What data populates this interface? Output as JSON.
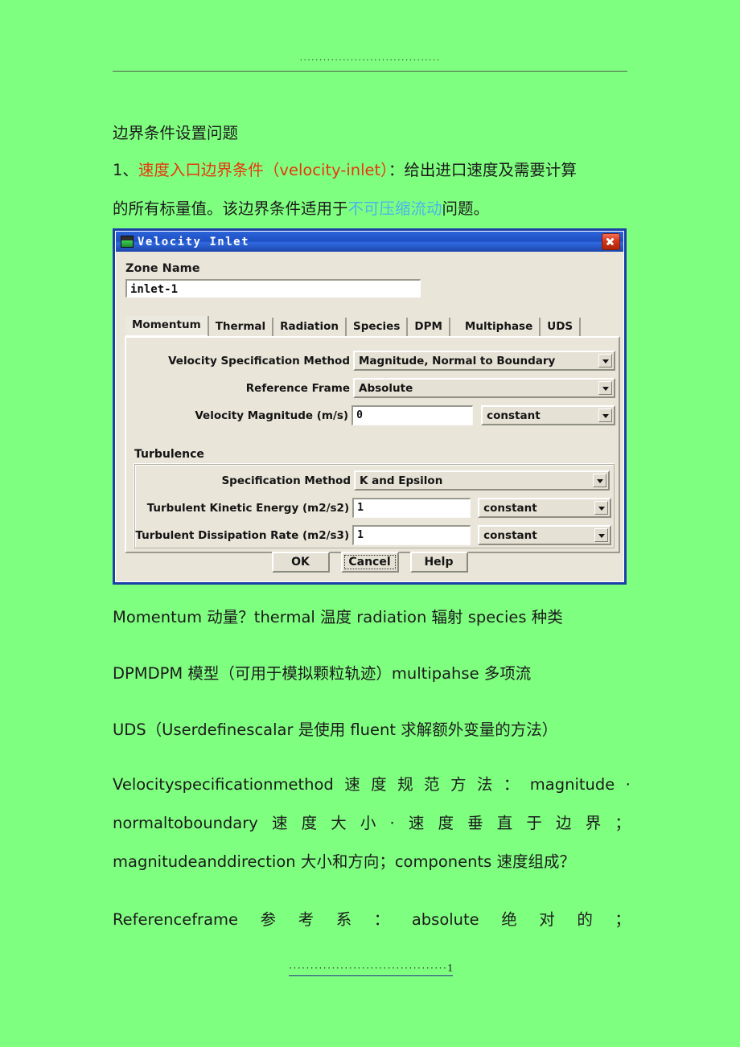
{
  "header": {
    "leader_dots": "····································",
    "rule": true
  },
  "document": {
    "title_line": "边界条件设置问题",
    "item1": {
      "number": "1、",
      "highlight": "速度入口边界条件（velocity-inlet）",
      "rest": "：给出进口速度及需要计算"
    },
    "item1_cont": {
      "pre": "的所有标量值。该边界条件适用于",
      "link": "不可压缩流动",
      "post": "问题。"
    },
    "note1": "Momentum 动量？thermal 温度 radiation 辐射 species 种类",
    "note2": "DPMDPM 模型（可用于模拟颗粒轨迹）multipahse 多项流",
    "note3": "UDS（Userdefinescalar 是使用 fluent 求解额外变量的方法）",
    "velocity_spec_line1": [
      "Velocityspecificationmethod",
      "速",
      "度",
      "规",
      "范",
      "方",
      "法",
      "：",
      "magnitude",
      "·"
    ],
    "velocity_spec_line2": [
      "normaltoboundary",
      "速",
      "度",
      "大",
      "小",
      "·",
      "速",
      "度",
      "垂",
      "直",
      "于",
      "边",
      "界",
      "；"
    ],
    "velocity_spec_line3": "magnitudeanddirection 大小和方向；components 速度组成？",
    "reference_frame_line": [
      "Referenceframe",
      "参",
      "考",
      "系",
      "：",
      "absolute",
      "绝",
      "对",
      "的",
      "；"
    ]
  },
  "footer": {
    "leader_dots": "·····································",
    "page_number": "1"
  },
  "dialog": {
    "title": "Velocity Inlet",
    "close_label": "×",
    "zone_name_label": "Zone Name",
    "zone_name_value": "inlet-1",
    "tabs": [
      {
        "label": "Momentum",
        "active": true
      },
      {
        "label": "Thermal",
        "active": false
      },
      {
        "label": "Radiation",
        "active": false
      },
      {
        "label": "Species",
        "active": false
      },
      {
        "label": "DPM",
        "active": false
      },
      {
        "label": "Multiphase",
        "active": false
      },
      {
        "label": "UDS",
        "active": false
      }
    ],
    "fields": {
      "velocity_spec_method": {
        "label": "Velocity Specification Method",
        "value": "Magnitude, Normal to Boundary"
      },
      "reference_frame": {
        "label": "Reference Frame",
        "value": "Absolute"
      },
      "velocity_magnitude": {
        "label": "Velocity Magnitude (m/s)",
        "value": "0",
        "profile": "constant"
      }
    },
    "turbulence": {
      "group_title": "Turbulence",
      "spec_method": {
        "label": "Specification Method",
        "value": "K and Epsilon"
      },
      "kinetic_energy": {
        "label": "Turbulent Kinetic Energy (m2/s2)",
        "value": "1",
        "profile": "constant"
      },
      "dissipation_rate": {
        "label": "Turbulent Dissipation Rate (m2/s3)",
        "value": "1",
        "profile": "constant"
      }
    },
    "buttons": {
      "ok": "OK",
      "cancel": "Cancel",
      "help": "Help"
    }
  },
  "colors": {
    "page_background": "#7fff80",
    "highlight_red": "#e8360d",
    "link_blue": "#4ab4ea",
    "dialog_panel": "#e9e5d9",
    "titlebar_blue": "#1f4fc4",
    "close_red": "#d3351b"
  }
}
